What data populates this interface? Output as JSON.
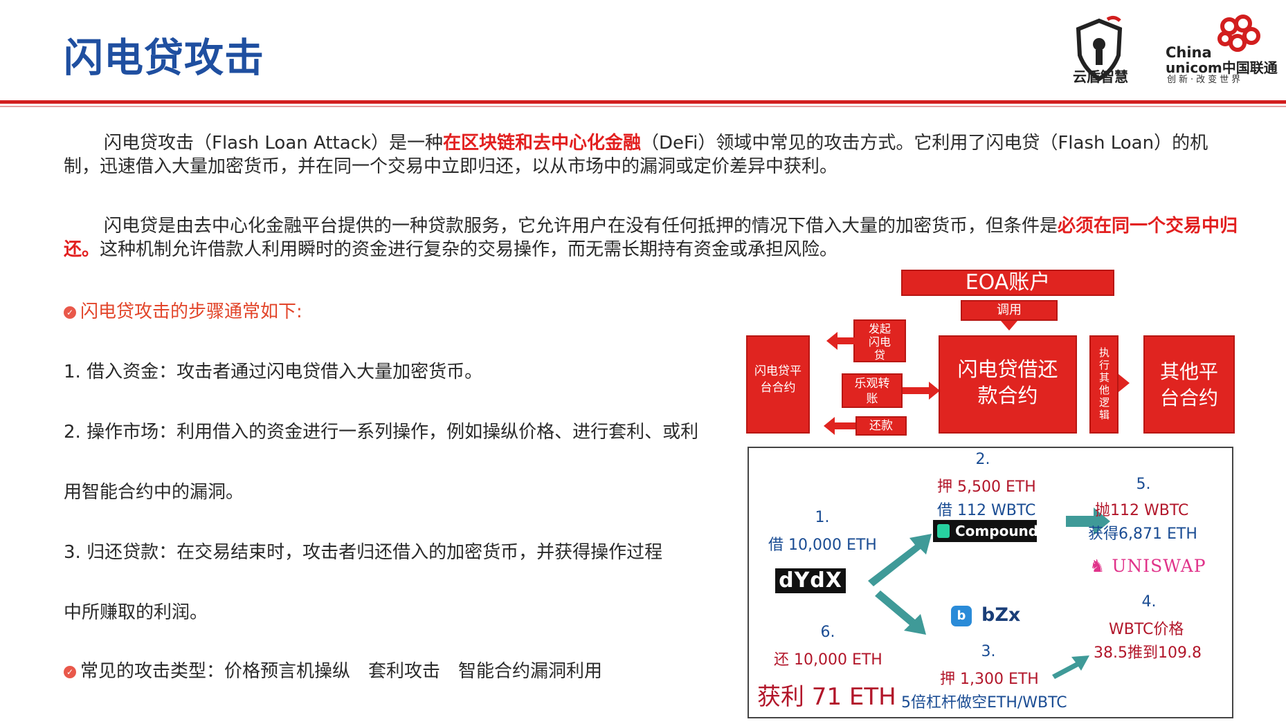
{
  "header": {
    "title": "闪电贷攻击",
    "logo_yundun": "云盾智慧",
    "logo_unicom": {
      "line1": "China",
      "line2": "unicom中国联通",
      "tagline": "创新·改变世界"
    }
  },
  "intro": {
    "p1": {
      "a": "闪电贷攻击（Flash Loan Attack）是一种",
      "b": "在区块链和去中心化金融",
      "c": "（DeFi）领域中常见的攻击方式。它利用了闪电贷（Flash Loan）的机制，迅速借入大量加密货币，并在同一个交易中立即归还，以从市场中的漏洞或定价差异中获利。"
    },
    "p2": {
      "a": "闪电贷是由去中心化金融平台提供的一种贷款服务，它允许用户在没有任何抵押的情况下借入大量的加密货币，但条件是",
      "b": "必须在同一个交易中归还。",
      "c": "这种机制允许借款人利用瞬时的资金进行复杂的交易操作，而无需长期持有资金或承担风险。"
    }
  },
  "steps": {
    "heading": "闪电贷攻击的步骤通常如下:",
    "s1": "1. 借入资金：攻击者通过闪电贷借入大量加密货币。",
    "s2a": "2. 操作市场：利用借入的资金进行一系列操作，例如操纵价格、进行套利、或利",
    "s2b": "用智能合约中的漏洞。",
    "s3a": "3. 归还贷款：在交易结束时，攻击者归还借入的加密货币，并获得操作过程",
    "s3b": "中所赚取的利润。",
    "types": "常见的攻击类型：价格预言机操纵　套利攻击　智能合约漏洞利用"
  },
  "flow": {
    "eoa": "EOA账户",
    "call": "调用",
    "flash_platform": "闪电贷平台合约",
    "initiate": "发起闪电贷",
    "transfer": "乐观转账",
    "repay": "还款",
    "core": "闪电贷借还款合约",
    "exec": "执行其他逻辑",
    "other": "其他平台合约"
  },
  "attack": {
    "s1_num": "1.",
    "s1_text": "借 10,000 ETH",
    "s2_num": "2.",
    "s2_l1": "押 5,500 ETH",
    "s2_l2": "借 112 WBTC",
    "s3_num": "3.",
    "s3_l1": "押 1,300 ETH",
    "s3_l2": "5倍杠杆做空ETH/WBTC",
    "s4_num": "4.",
    "s4_l1": "WBTC价格",
    "s4_l2": "38.5推到109.8",
    "s5_num": "5.",
    "s5_l1": "抛112 WBTC",
    "s5_l2": "获得6,871 ETH",
    "s6_num": "6.",
    "s6_l1": "还 10,000 ETH",
    "profit": "获利 71 ETH",
    "logo_dydx": "dYdX",
    "logo_compound": "Compound",
    "logo_uniswap": "UNISWAP",
    "logo_bzx": "bZx"
  },
  "colors": {
    "title_blue": "#1f4fa0",
    "accent_red": "#e02420",
    "teal_arrow": "#3f9a98"
  }
}
